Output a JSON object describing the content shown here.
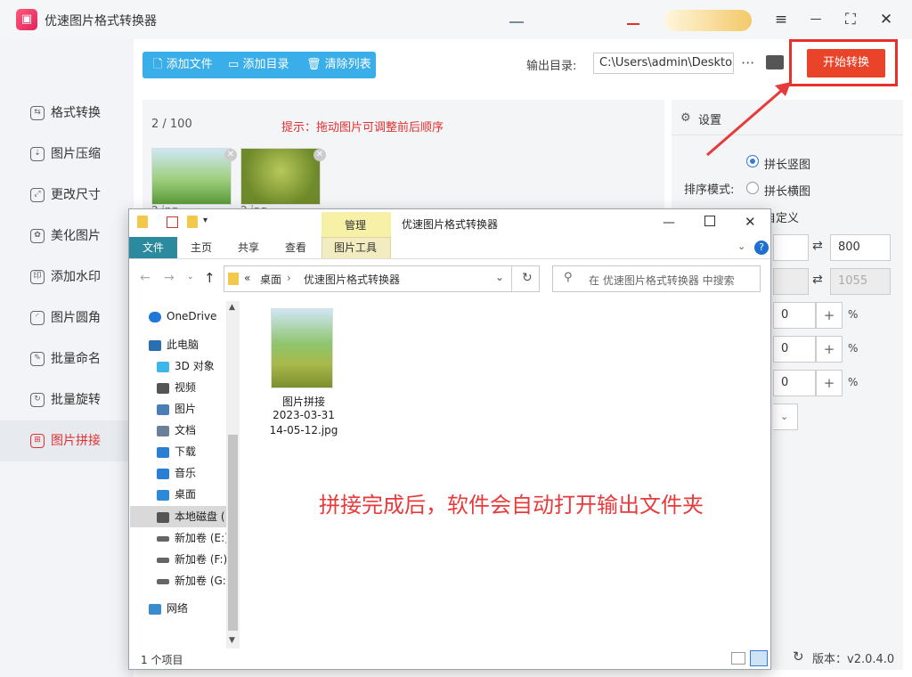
{
  "app": {
    "title": "优速图片格式转换器",
    "logo_glyph": "▣"
  },
  "window_controls": {
    "menu": "≡",
    "minimize": "—",
    "maximize": "⛶",
    "close": "✕"
  },
  "sidebar": {
    "items": [
      {
        "label": "格式转换",
        "icon": "format-convert-icon",
        "glyph": "⇆",
        "active": false
      },
      {
        "label": "图片压缩",
        "icon": "compress-icon",
        "glyph": "⇣",
        "active": false
      },
      {
        "label": "更改尺寸",
        "icon": "resize-icon",
        "glyph": "⤢",
        "active": false
      },
      {
        "label": "美化图片",
        "icon": "beautify-icon",
        "glyph": "✿",
        "active": false
      },
      {
        "label": "添加水印",
        "icon": "watermark-icon",
        "glyph": "印",
        "active": false
      },
      {
        "label": "图片圆角",
        "icon": "rounded-corner-icon",
        "glyph": "◜",
        "active": false
      },
      {
        "label": "批量命名",
        "icon": "rename-icon",
        "glyph": "✎",
        "active": false
      },
      {
        "label": "批量旋转",
        "icon": "rotate-icon",
        "glyph": "↻",
        "active": false
      },
      {
        "label": "图片拼接",
        "icon": "stitch-icon",
        "glyph": "⊞",
        "active": true
      }
    ]
  },
  "toolbar": {
    "add_file": "添加文件",
    "add_dir": "添加目录",
    "clear_list": "清除列表",
    "output_label": "输出目录:",
    "output_path": "C:\\Users\\admin\\Deskto",
    "more": "···",
    "start": "开始转换"
  },
  "list": {
    "count": "2 / 100",
    "hint": "提示：拖动图片可调整前后顺序",
    "files": [
      {
        "name": "2.jpg"
      },
      {
        "name": "2.jpg"
      }
    ]
  },
  "settings": {
    "title": "设置",
    "sort_label": "排序模式:",
    "options": [
      {
        "label": "拼长竖图",
        "selected": true
      },
      {
        "label": "拼长横图",
        "selected": false
      },
      {
        "label": "自定义",
        "selected": false
      }
    ],
    "width_value": "800",
    "height_value": "1055",
    "rows": [
      {
        "value": "0",
        "unit": "%"
      },
      {
        "value": "0",
        "unit": "%"
      },
      {
        "value": "0",
        "unit": "%"
      }
    ],
    "version": "版本：v2.0.4.0"
  },
  "explorer": {
    "title": "优速图片格式转换器",
    "context_tab_top": "管理",
    "context_tab": "图片工具",
    "tabs": [
      "文件",
      "主页",
      "共享",
      "查看"
    ],
    "address": [
      "«",
      "桌面",
      "›",
      "优速图片格式转换器"
    ],
    "search_placeholder": "在 优速图片格式转换器 中搜索",
    "nav": [
      {
        "label": "OneDrive",
        "icon": "onedrive-icon",
        "color": "#1e78d6"
      },
      {
        "label": "此电脑",
        "icon": "computer-icon",
        "color": "#2b6fb3"
      },
      {
        "label": "3D 对象",
        "icon": "3d-objects-icon",
        "color": "#3fb6e8"
      },
      {
        "label": "视频",
        "icon": "video-icon",
        "color": "#555555"
      },
      {
        "label": "图片",
        "icon": "pictures-icon",
        "color": "#4a7fb5"
      },
      {
        "label": "文档",
        "icon": "documents-icon",
        "color": "#6b7f99"
      },
      {
        "label": "下载",
        "icon": "downloads-icon",
        "color": "#2a7fd4"
      },
      {
        "label": "音乐",
        "icon": "music-icon",
        "color": "#2a7fd4"
      },
      {
        "label": "桌面",
        "icon": "desktop-icon",
        "color": "#2a8ad8"
      },
      {
        "label": "本地磁盘 (",
        "icon": "local-disk-icon",
        "color": "#555555"
      },
      {
        "label": "新加卷 (E:)",
        "icon": "drive-icon",
        "color": "#666666"
      },
      {
        "label": "新加卷 (F:)",
        "icon": "drive-icon",
        "color": "#666666"
      },
      {
        "label": "新加卷 (G:",
        "icon": "drive-icon",
        "color": "#666666"
      },
      {
        "label": "网络",
        "icon": "network-icon",
        "color": "#3a8ad0"
      }
    ],
    "file": {
      "line1": "图片拼接",
      "line2": "2023-03-31",
      "line3": "14-05-12.jpg"
    },
    "status": "1 个项目"
  },
  "annotation": "拼接完成后，软件会自动打开输出文件夹",
  "colors": {
    "accent_red": "#e9442a",
    "toolbar_blue": "#3aaee8",
    "active_red": "#e03030"
  }
}
